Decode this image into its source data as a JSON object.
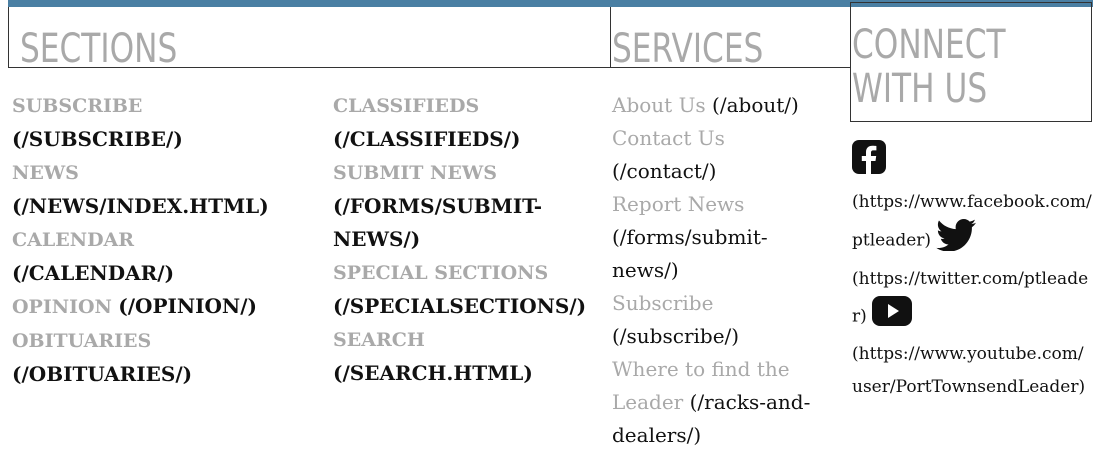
{
  "colors": {
    "topbar": "#4a7fa3",
    "heading": "#a9a9a9",
    "label": "#a9a9a9",
    "href": "#111111",
    "border": "#333333"
  },
  "headings": {
    "sections": "SECTIONS",
    "services": "SERVICES",
    "connect": "CONNECT WITH US"
  },
  "sections_col1": [
    {
      "label": "SUBSCRIBE",
      "href": "(/SUBSCRIBE/)"
    },
    {
      "label": "NEWS",
      "href": "(/NEWS/INDEX.HTML)"
    },
    {
      "label": "CALENDAR",
      "href": "(/CALENDAR/)"
    },
    {
      "label": "OPINION",
      "href": "(/OPINION/)"
    },
    {
      "label": "OBITUARIES",
      "href": "(/OBITUARIES/)"
    }
  ],
  "sections_col2": [
    {
      "label": "CLASSIFIEDS",
      "href": "(/CLASSIFIEDS/)"
    },
    {
      "label": "SUBMIT NEWS",
      "href": "(/FORMS/SUBMIT-NEWS/)"
    },
    {
      "label": "SPECIAL SECTIONS",
      "href": "(/SPECIALSECTIONS/)"
    },
    {
      "label": "SEARCH",
      "href": "(/SEARCH.HTML)"
    }
  ],
  "services": [
    {
      "label": "About Us",
      "href": "(/about/)"
    },
    {
      "label": "Contact Us",
      "href": "(/contact/)"
    },
    {
      "label": "Report News",
      "href": "(/forms/submit-news/)"
    },
    {
      "label": "Subscribe",
      "href": "(/subscribe/)"
    },
    {
      "label": "Where to find the Leader",
      "href": "(/racks-and-dealers/)"
    }
  ],
  "connect": [
    {
      "icon": "facebook-icon",
      "href": "(https://www.facebook.com/ptleader)"
    },
    {
      "icon": "twitter-icon",
      "href": "(https://twitter.com/ptleader)"
    },
    {
      "icon": "youtube-icon",
      "href": "(https://www.youtube.com/user/PortTownsendLeader)"
    }
  ]
}
